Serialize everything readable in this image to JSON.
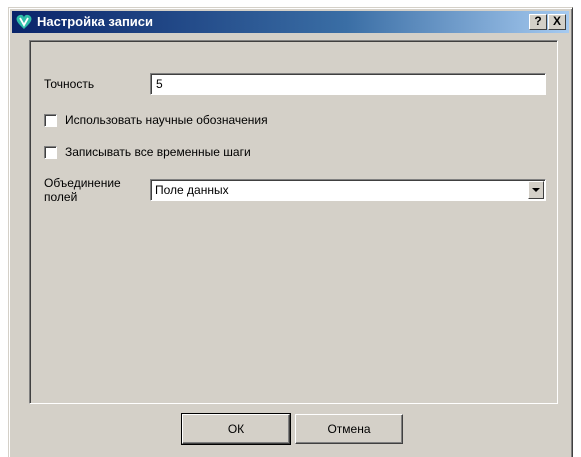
{
  "window": {
    "title": "Настройка записи",
    "help_glyph": "?",
    "close_glyph": "X"
  },
  "form": {
    "precision_label": "Точность",
    "precision_value": "5",
    "scientific_label": "Использовать научные обозначения",
    "scientific_checked": false,
    "timesteps_label": "Записывать все временные шаги",
    "timesteps_checked": false,
    "merge_label": "Объединение полей",
    "merge_value": "Поле данных"
  },
  "buttons": {
    "ok_label": "ОК",
    "cancel_label": "Отмена"
  },
  "icons": {
    "app": "paraview-logo-icon",
    "dropdown": "chevron-down-icon"
  },
  "colors": {
    "title_start": "#0a246a",
    "title_end": "#a6caf0",
    "face": "#d4d0c8",
    "logo": "#2fbfa9"
  }
}
